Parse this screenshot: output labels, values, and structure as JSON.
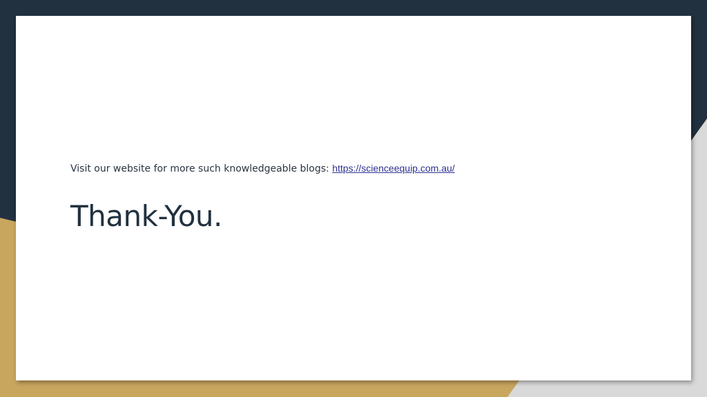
{
  "slide": {
    "visit_text": "Visit our website for more such knowledgeable blogs: ",
    "link_text": "https://scienceequip.com.au/",
    "title": "Thank-You."
  },
  "colors": {
    "navy": "#22313f",
    "gold": "#c9a65e",
    "gray": "#d9d9d9",
    "link": "#2e3192"
  }
}
